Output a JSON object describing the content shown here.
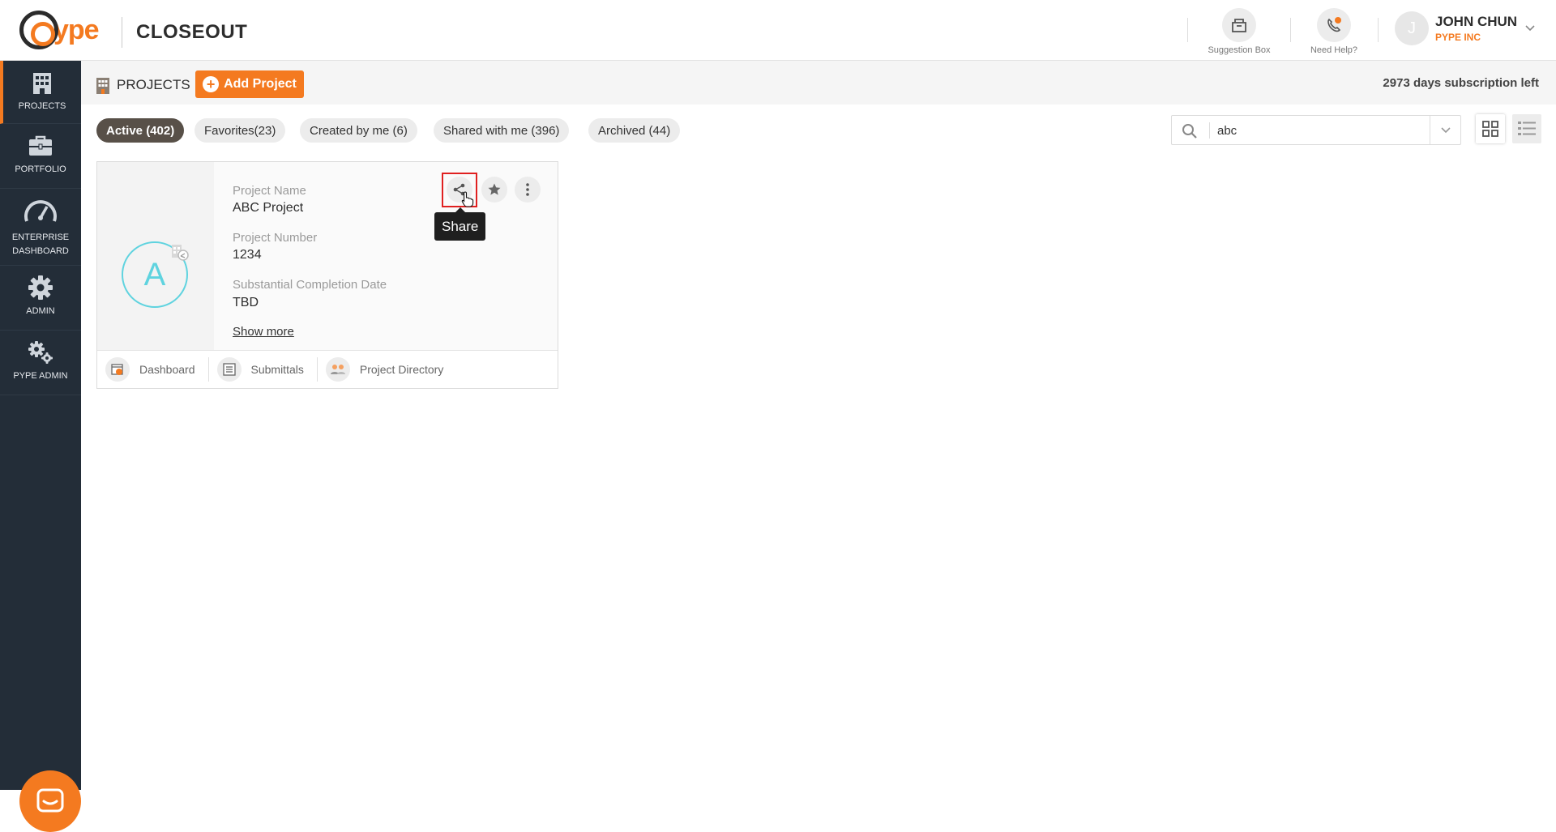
{
  "header": {
    "logo_text": "ype",
    "app_title": "CLOSEOUT",
    "suggestion_box_label": "Suggestion Box",
    "need_help_label": "Need Help?",
    "user": {
      "initial": "J",
      "name": "JOHN CHUN",
      "company": "PYPE INC"
    }
  },
  "sidebar": {
    "items": [
      {
        "label": "PROJECTS",
        "icon": "building-icon",
        "active": true
      },
      {
        "label": "PORTFOLIO",
        "icon": "briefcase-icon",
        "active": false
      },
      {
        "label": "ENTERPRISE DASHBOARD",
        "icon": "speedometer-icon",
        "active": false
      },
      {
        "label": "ADMIN",
        "icon": "gear-icon",
        "active": false
      },
      {
        "label": "PYPE ADMIN",
        "icon": "gears-icon",
        "active": false
      }
    ]
  },
  "topbar": {
    "title": "PROJECTS",
    "add_project_label": "Add Project",
    "subscription_text": "2973 days subscription left"
  },
  "filters": [
    {
      "label": "Active (402)",
      "active": true
    },
    {
      "label": "Favorites(23)",
      "active": false
    },
    {
      "label": "Created by me (6)",
      "active": false
    },
    {
      "label": "Shared with me (396)",
      "active": false
    },
    {
      "label": "Archived (44)",
      "active": false
    }
  ],
  "search": {
    "value": "abc"
  },
  "project_card": {
    "avatar_letter": "A",
    "project_name_label": "Project Name",
    "project_name": "ABC Project",
    "project_number_label": "Project Number",
    "project_number": "1234",
    "completion_label": "Substantial Completion Date",
    "completion_value": "TBD",
    "show_more": "Show more",
    "tooltip": "Share",
    "footer_links": [
      {
        "label": "Dashboard",
        "icon": "dashboard-icon"
      },
      {
        "label": "Submittals",
        "icon": "submittals-icon"
      },
      {
        "label": "Project Directory",
        "icon": "directory-icon"
      }
    ]
  },
  "colors": {
    "accent": "#f47a20",
    "sidebar": "#232d38",
    "active_filter": "#585048",
    "avatar_ring": "#5fd3df"
  }
}
